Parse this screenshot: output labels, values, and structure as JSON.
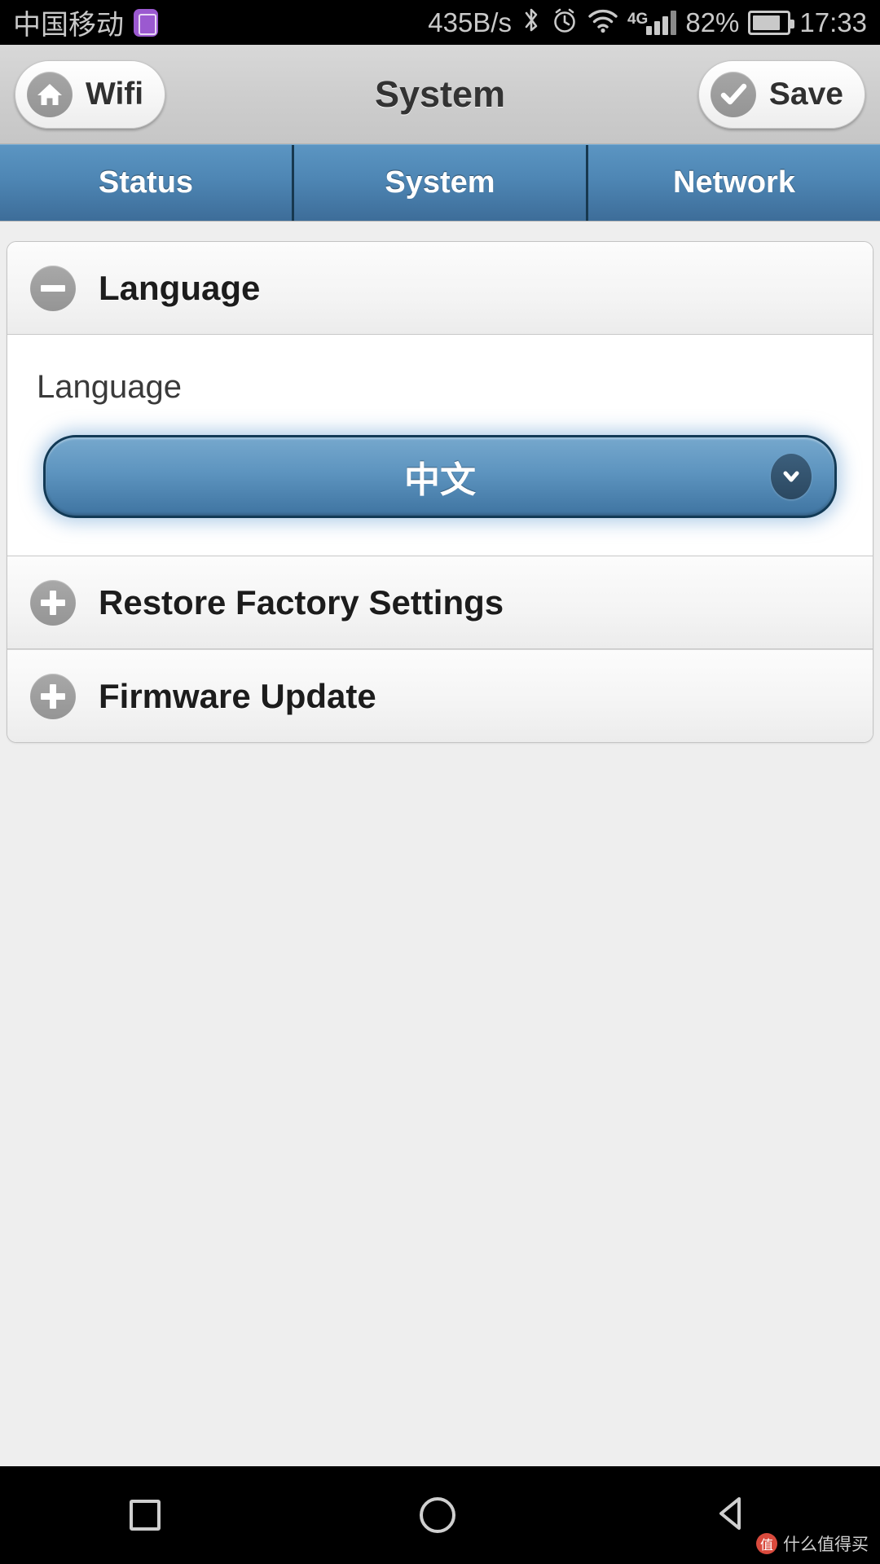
{
  "status_bar": {
    "carrier": "中国移动",
    "badge_icon": "sim-card-icon",
    "network_speed": "435B/s",
    "bluetooth_icon": "bluetooth-icon",
    "alarm_icon": "alarm-clock-icon",
    "wifi_icon": "wifi-icon",
    "network_type": "4G",
    "signal_icon": "signal-bars-icon",
    "battery_percent": "82%",
    "battery_icon": "battery-icon",
    "time": "17:33"
  },
  "title_bar": {
    "back_button": {
      "label": "Wifi",
      "icon": "home-icon"
    },
    "title": "System",
    "save_button": {
      "label": "Save",
      "icon": "check-icon"
    }
  },
  "tabs": [
    {
      "label": "Status",
      "active": false
    },
    {
      "label": "System",
      "active": true
    },
    {
      "label": "Network",
      "active": false
    }
  ],
  "sections": [
    {
      "title": "Language",
      "toggle_icon": "minus-circle-icon",
      "expanded": true,
      "field_label": "Language",
      "select": {
        "value": "中文",
        "arrow_icon": "chevron-down-icon"
      }
    },
    {
      "title": "Restore Factory Settings",
      "toggle_icon": "plus-circle-icon",
      "expanded": false
    },
    {
      "title": "Firmware Update",
      "toggle_icon": "plus-circle-icon",
      "expanded": false
    }
  ],
  "nav_bar": {
    "recents_icon": "square-icon",
    "home_icon": "circle-icon",
    "back_icon": "triangle-back-icon"
  },
  "watermark": {
    "badge": "值",
    "text": "什么值得买"
  },
  "colors": {
    "tab_blue": "#4e86b4",
    "select_blue": "#5d94bf",
    "accent_border": "#123a56"
  }
}
